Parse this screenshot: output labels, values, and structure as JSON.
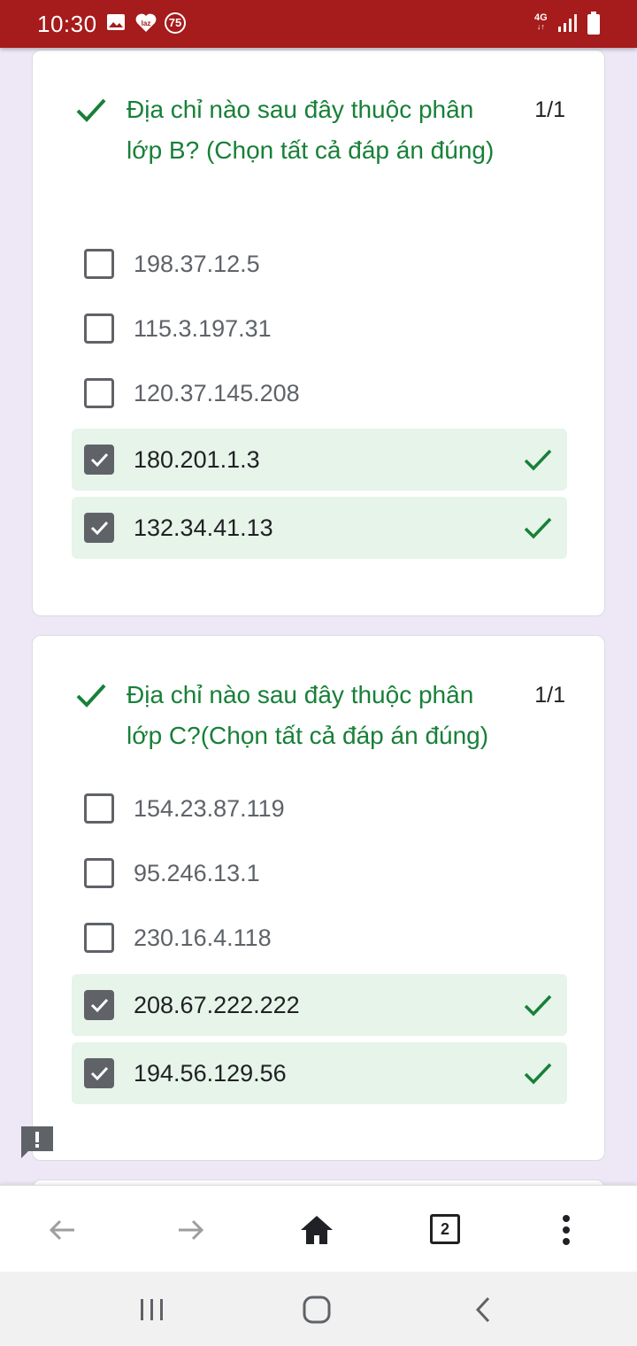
{
  "status_bar": {
    "time": "10:30",
    "badge_count": "75",
    "network": "4G",
    "icons": [
      "gallery-icon",
      "lazada-icon",
      "notification-count-icon",
      "4g-icon",
      "signal-icon",
      "battery-icon"
    ]
  },
  "questions": [
    {
      "title": "Địa chỉ nào sau đây thuộc phân lớp B? (Chọn tất cả đáp án đúng)",
      "score": "1/1",
      "options": [
        {
          "label": "198.37.12.5",
          "checked": false,
          "correct": false
        },
        {
          "label": "115.3.197.31",
          "checked": false,
          "correct": false
        },
        {
          "label": "120.37.145.208",
          "checked": false,
          "correct": false
        },
        {
          "label": "180.201.1.3",
          "checked": true,
          "correct": true
        },
        {
          "label": "132.34.41.13",
          "checked": true,
          "correct": true
        }
      ]
    },
    {
      "title": "Địa chỉ nào sau đây thuộc phân lớp C?(Chọn tất cả đáp án đúng)",
      "score": "1/1",
      "options": [
        {
          "label": "154.23.87.119",
          "checked": false,
          "correct": false
        },
        {
          "label": "95.246.13.1",
          "checked": false,
          "correct": false
        },
        {
          "label": "230.16.4.118",
          "checked": false,
          "correct": false
        },
        {
          "label": "208.67.222.222",
          "checked": true,
          "correct": true
        },
        {
          "label": "194.56.129.56",
          "checked": true,
          "correct": true
        }
      ]
    }
  ],
  "browser_nav": {
    "tab_count": "2",
    "icons": [
      "back-arrow-icon",
      "forward-arrow-icon",
      "home-icon",
      "tabs-icon",
      "more-vert-icon"
    ]
  },
  "colors": {
    "status_bar": "#a61b1b",
    "page_background": "#ede7f6",
    "correct_green": "#188038",
    "correct_fill": "#e6f4ea",
    "checkbox_grey": "#5f6368"
  }
}
